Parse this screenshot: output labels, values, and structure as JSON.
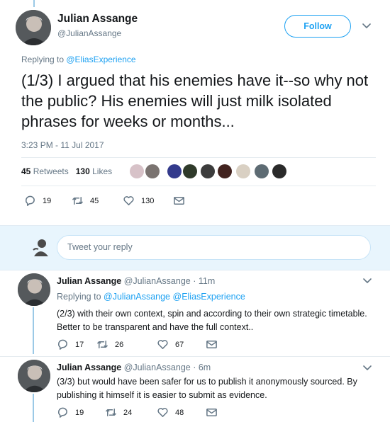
{
  "main_tweet": {
    "author_name": "Julian Assange",
    "author_handle": "@JulianAssange",
    "follow_label": "Follow",
    "replying_prefix": "Replying to ",
    "replying_to": "@EliasExperience",
    "text": "(1/3) I argued that his enemies have it--so why not the public? His enemies will just milk isolated phrases for weeks or months...",
    "timestamp": "3:23 PM - 11 Jul 2017",
    "retweets_count": "45",
    "retweets_label": "Retweets",
    "likes_count": "130",
    "likes_label": "Likes",
    "actions": {
      "replies": "19",
      "retweets": "45",
      "likes": "130"
    }
  },
  "compose": {
    "placeholder": "Tweet your reply"
  },
  "replies": [
    {
      "author_name": "Julian Assange",
      "author_handle": "@JulianAssange",
      "time": " · 11m",
      "replying_prefix": "Replying to ",
      "replying_to_1": "@JulianAssange",
      "replying_to_2": "@EliasExperience",
      "text": "(2/3) with their own context, spin and according to their own strategic timetable. Better to be transparent and have the full context..",
      "actions": {
        "replies": "17",
        "retweets": "26",
        "likes": "67"
      }
    },
    {
      "author_name": "Julian Assange",
      "author_handle": "@JulianAssange",
      "time": " · 6m",
      "text": "(3/3) but would have been safer for us to publish it anonymously sourced. By publishing it himself it is easier to submit as evidence.",
      "actions": {
        "replies": "19",
        "retweets": "24",
        "likes": "48"
      }
    }
  ],
  "colors": {
    "accent": "#1da1f2",
    "secondary_text": "#657786",
    "thread_line": "#9bc9e6"
  },
  "icons": [
    "reply-icon",
    "retweet-icon",
    "like-icon",
    "message-icon",
    "chevron-down-icon",
    "user-icon"
  ]
}
